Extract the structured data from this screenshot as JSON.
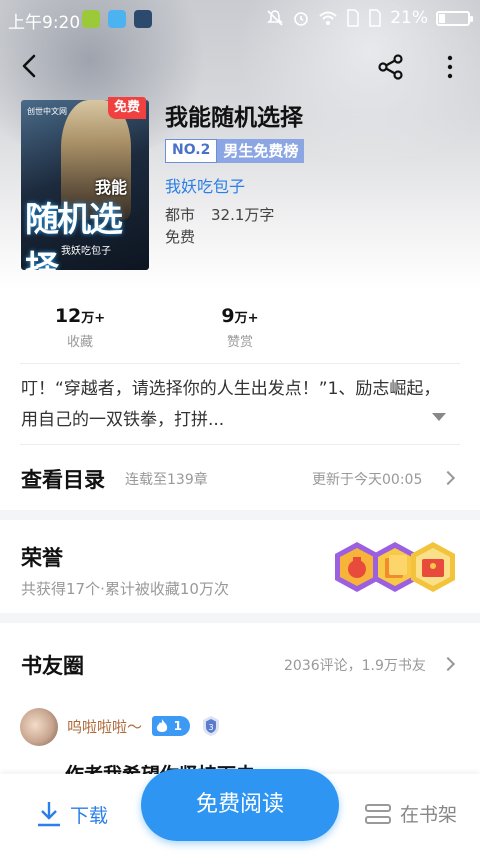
{
  "status_bar": {
    "time": "上午9:20",
    "battery": "21%",
    "battery_level": 0.21
  },
  "book": {
    "title": "我能随机选择",
    "cover_free_tag": "免费",
    "cover_title_small": "我能",
    "cover_title_big": "随机选择",
    "cover_author": "我妖吃包子",
    "cover_brand": "创世中文网",
    "rank_no": "NO.2",
    "rank_label": "男生免费榜",
    "author": "我妖吃包子",
    "genre": "都市",
    "word_count": "32.1万字",
    "price": "免费"
  },
  "stats": [
    {
      "value": "12",
      "unit": "万+",
      "label": "收藏"
    },
    {
      "value": "9",
      "unit": "万+",
      "label": "赞赏"
    }
  ],
  "intro": "叮！“穿越者，请选择你的人生出发点！”1、励志崛起，用自己的一双铁拳，打拼...",
  "catalog": {
    "title": "查看目录",
    "progress": "连载至139章",
    "update": "更新于今天00:05"
  },
  "honor": {
    "title": "荣誉",
    "desc": "共获得17个·累计被收藏10万次"
  },
  "circle": {
    "title": "书友圈",
    "summary": "2036评论，1.9万书友",
    "first_post": {
      "user": "呜啦啦啦～",
      "level": "1",
      "fan_level": "3",
      "text": "作者我希望你坚持下去"
    }
  },
  "bottom": {
    "download": "下载",
    "read": "免费阅读",
    "shelf": "在书架"
  },
  "colors": {
    "accent": "#2e95f2",
    "link": "#2a7fe8",
    "free_tag": "#f04040",
    "rank": "#8ca6e4"
  },
  "icons": [
    "back-arrow-icon",
    "share-icon",
    "more-vertical-icon",
    "download-icon",
    "bookshelf-icon",
    "chevron-right-icon",
    "expand-caret-icon"
  ]
}
